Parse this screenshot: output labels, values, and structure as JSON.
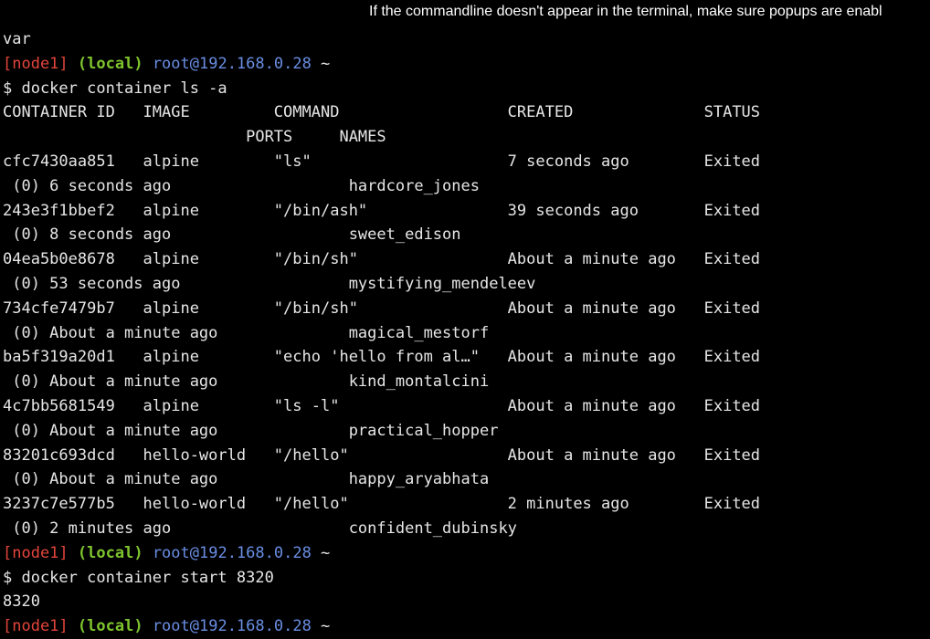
{
  "notice": "If the commandline doesn't appear in the terminal, make sure popups are enabl",
  "lines": [
    {
      "type": "plain",
      "text": "var"
    },
    {
      "type": "prompt",
      "node": "[node1]",
      "sep1": " ",
      "local": "(local)",
      "sep2": " ",
      "user": "root@192.168.0.28",
      "tail": " ~"
    },
    {
      "type": "plain",
      "text": "$ docker container ls -a"
    },
    {
      "type": "plain",
      "text": "CONTAINER ID   IMAGE         COMMAND                  CREATED              STATUS"
    },
    {
      "type": "plain",
      "text": "                          PORTS     NAMES"
    },
    {
      "type": "plain",
      "text": "cfc7430aa851   alpine        \"ls\"                     7 seconds ago        Exited"
    },
    {
      "type": "plain",
      "text": " (0) 6 seconds ago                   hardcore_jones"
    },
    {
      "type": "plain",
      "text": "243e3f1bbef2   alpine        \"/bin/ash\"               39 seconds ago       Exited"
    },
    {
      "type": "plain",
      "text": " (0) 8 seconds ago                   sweet_edison"
    },
    {
      "type": "plain",
      "text": "04ea5b0e8678   alpine        \"/bin/sh\"                About a minute ago   Exited"
    },
    {
      "type": "plain",
      "text": " (0) 53 seconds ago                  mystifying_mendeleev"
    },
    {
      "type": "plain",
      "text": "734cfe7479b7   alpine        \"/bin/sh\"                About a minute ago   Exited"
    },
    {
      "type": "plain",
      "text": " (0) About a minute ago              magical_mestorf"
    },
    {
      "type": "plain",
      "text": "ba5f319a20d1   alpine        \"echo 'hello from al…\"   About a minute ago   Exited"
    },
    {
      "type": "plain",
      "text": " (0) About a minute ago              kind_montalcini"
    },
    {
      "type": "plain",
      "text": "4c7bb5681549   alpine        \"ls -l\"                  About a minute ago   Exited"
    },
    {
      "type": "plain",
      "text": " (0) About a minute ago              practical_hopper"
    },
    {
      "type": "plain",
      "text": "83201c693dcd   hello-world   \"/hello\"                 About a minute ago   Exited"
    },
    {
      "type": "plain",
      "text": " (0) About a minute ago              happy_aryabhata"
    },
    {
      "type": "plain",
      "text": "3237c7e577b5   hello-world   \"/hello\"                 2 minutes ago        Exited"
    },
    {
      "type": "plain",
      "text": " (0) 2 minutes ago                   confident_dubinsky"
    },
    {
      "type": "prompt",
      "node": "[node1]",
      "sep1": " ",
      "local": "(local)",
      "sep2": " ",
      "user": "root@192.168.0.28",
      "tail": " ~"
    },
    {
      "type": "plain",
      "text": "$ docker container start 8320"
    },
    {
      "type": "plain",
      "text": "8320"
    },
    {
      "type": "prompt",
      "node": "[node1]",
      "sep1": " ",
      "local": "(local)",
      "sep2": " ",
      "user": "root@192.168.0.28",
      "tail": " ~"
    }
  ],
  "colors": {
    "background": "#000000",
    "text": "#e6e6e6",
    "node": "#e3453b",
    "local": "#7ec42e",
    "user": "#6a8ee3"
  }
}
